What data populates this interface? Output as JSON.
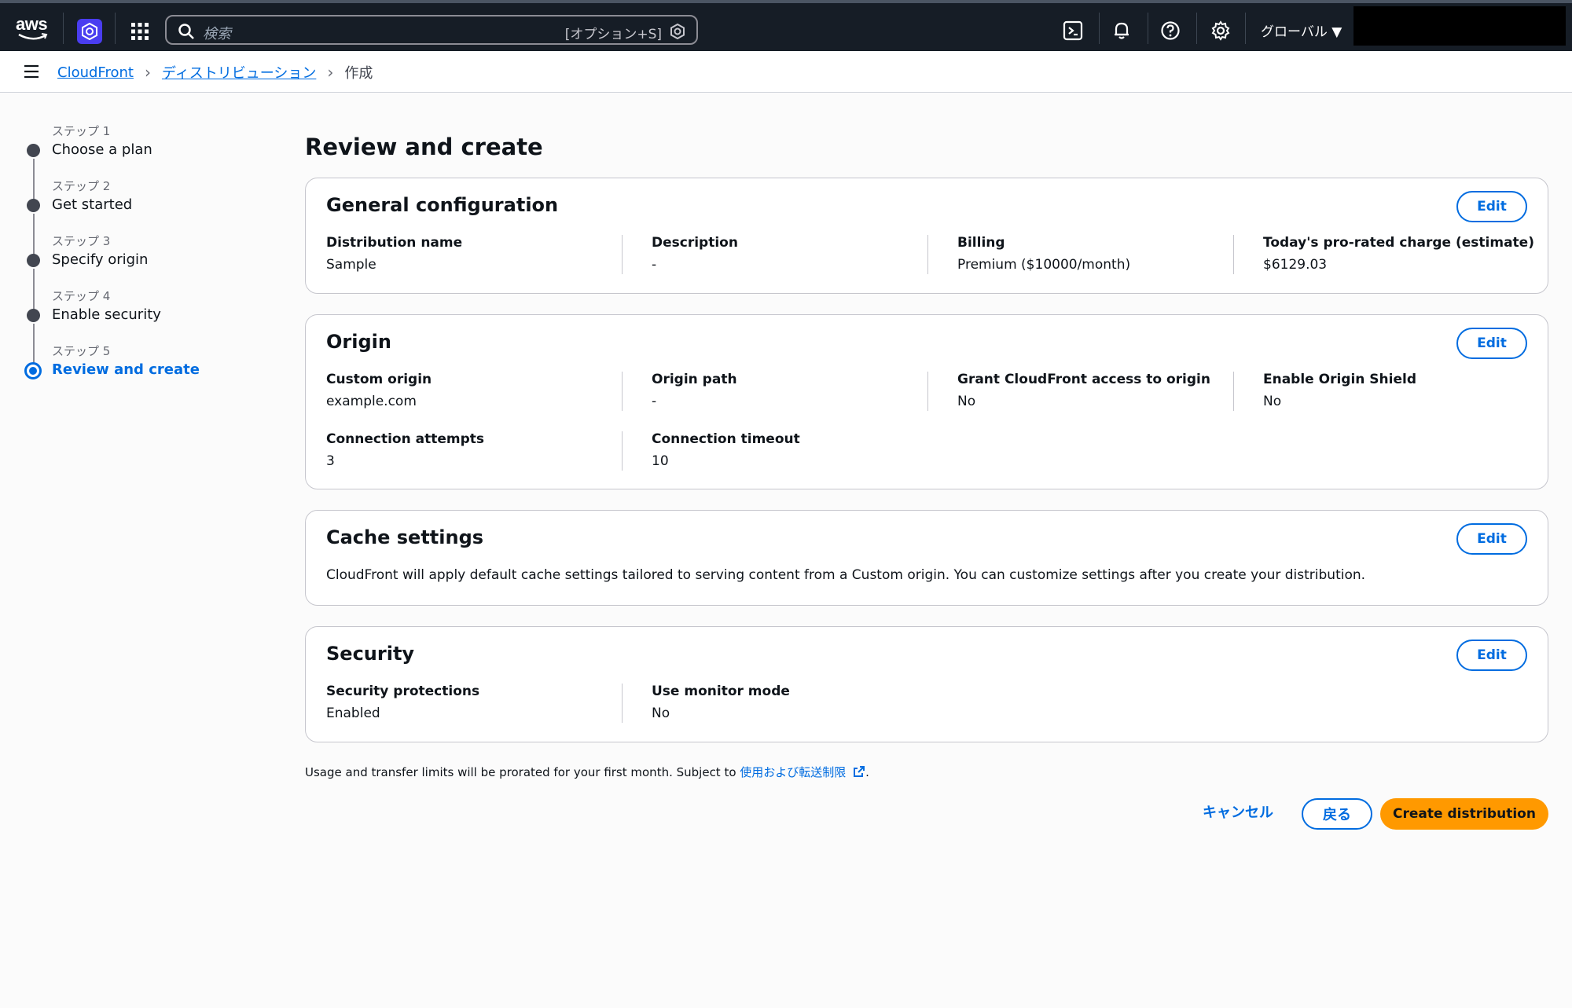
{
  "topnav": {
    "logo_text": "aws",
    "search_placeholder": "検索",
    "search_shortcut": "[オプション+S]",
    "region": "グローバル ▼"
  },
  "breadcrumb": {
    "items": [
      "CloudFront",
      "ディストリビューション"
    ],
    "current": "作成"
  },
  "steps": [
    {
      "num": "ステップ 1",
      "title": "Choose a plan"
    },
    {
      "num": "ステップ 2",
      "title": "Get started"
    },
    {
      "num": "ステップ 3",
      "title": "Specify origin"
    },
    {
      "num": "ステップ 4",
      "title": "Enable security"
    },
    {
      "num": "ステップ 5",
      "title": "Review and create"
    }
  ],
  "page_title": "Review and create",
  "edit_label": "Edit",
  "general": {
    "title": "General configuration",
    "fields": [
      {
        "k": "Distribution name",
        "v": "Sample"
      },
      {
        "k": "Description",
        "v": "-"
      },
      {
        "k": "Billing",
        "v": "Premium ($10000/month)"
      },
      {
        "k": "Today's pro-rated charge (estimate)",
        "v": "$6129.03"
      }
    ]
  },
  "origin": {
    "title": "Origin",
    "fields": [
      {
        "k": "Custom origin",
        "v": "example.com"
      },
      {
        "k": "Origin path",
        "v": "-"
      },
      {
        "k": "Grant CloudFront access to origin",
        "v": "No"
      },
      {
        "k": "Enable Origin Shield",
        "v": "No"
      },
      {
        "k": "Connection attempts",
        "v": "3"
      },
      {
        "k": "Connection timeout",
        "v": "10"
      }
    ]
  },
  "cache": {
    "title": "Cache settings",
    "desc": "CloudFront will apply default cache settings tailored to serving content from a Custom origin. You can customize settings after you create your distribution."
  },
  "security": {
    "title": "Security",
    "fields": [
      {
        "k": "Security protections",
        "v": "Enabled"
      },
      {
        "k": "Use monitor mode",
        "v": "No"
      }
    ]
  },
  "footnote": {
    "text": "Usage and transfer limits will be prorated for your first month. Subject to ",
    "link": "使用および転送制限",
    "end": "."
  },
  "actions": {
    "cancel": "キャンセル",
    "back": "戻る",
    "create": "Create distribution"
  }
}
